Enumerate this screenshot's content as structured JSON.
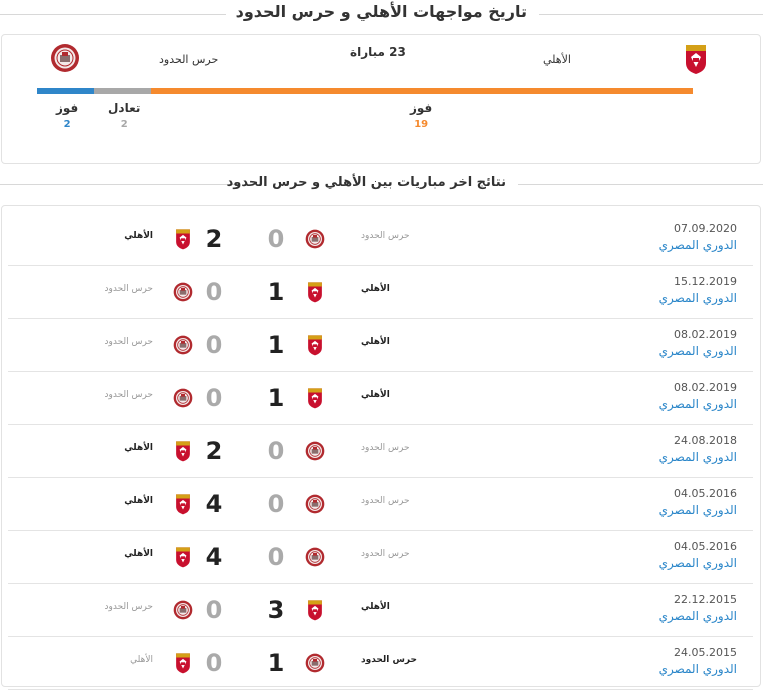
{
  "header": {
    "title": "تاريخ مواجهات الأهلي و حرس الحدود"
  },
  "summary": {
    "team_a": "الأهلي",
    "team_b": "حرس الحدود",
    "total": "23 مباراة",
    "wins_a_label": "فوز",
    "wins_a": "19",
    "draws_label": "تعادل",
    "draws": "2",
    "wins_b_label": "فوز",
    "wins_b": "2",
    "colors": {
      "team_a": "#f58a2e",
      "draw": "#a8a8a8",
      "team_b": "#2f86c9"
    },
    "bar_fractions": {
      "team_b": 0.087,
      "draw": 0.087,
      "team_a": 0.826
    }
  },
  "results": {
    "title": "نتائج اخر مباريات بين الأهلي و حرس الحدود",
    "rows": [
      {
        "date": "07.09.2020",
        "competition": "الدوري المصري",
        "home": "حرس الحدود",
        "home_logo": "haras-crest",
        "home_score": "0",
        "away_score": "2",
        "away": "الأهلي",
        "away_logo": "ahly-crest",
        "winner": "away"
      },
      {
        "date": "15.12.2019",
        "competition": "الدوري المصري",
        "home": "الأهلي",
        "home_logo": "ahly-crest",
        "home_score": "1",
        "away_score": "0",
        "away": "حرس الحدود",
        "away_logo": "haras-crest",
        "winner": "home"
      },
      {
        "date": "08.02.2019",
        "competition": "الدوري المصري",
        "home": "الأهلي",
        "home_logo": "ahly-crest",
        "home_score": "1",
        "away_score": "0",
        "away": "حرس الحدود",
        "away_logo": "haras-crest",
        "winner": "home"
      },
      {
        "date": "08.02.2019",
        "competition": "الدوري المصري",
        "home": "الأهلي",
        "home_logo": "ahly-crest",
        "home_score": "1",
        "away_score": "0",
        "away": "حرس الحدود",
        "away_logo": "haras-crest",
        "winner": "home"
      },
      {
        "date": "24.08.2018",
        "competition": "الدوري المصري",
        "home": "حرس الحدود",
        "home_logo": "haras-crest",
        "home_score": "0",
        "away_score": "2",
        "away": "الأهلي",
        "away_logo": "ahly-crest",
        "winner": "away"
      },
      {
        "date": "04.05.2016",
        "competition": "الدوري المصري",
        "home": "حرس الحدود",
        "home_logo": "haras-crest",
        "home_score": "0",
        "away_score": "4",
        "away": "الأهلي",
        "away_logo": "ahly-crest",
        "winner": "away"
      },
      {
        "date": "04.05.2016",
        "competition": "الدوري المصري",
        "home": "حرس الحدود",
        "home_logo": "haras-crest",
        "home_score": "0",
        "away_score": "4",
        "away": "الأهلي",
        "away_logo": "ahly-crest",
        "winner": "away"
      },
      {
        "date": "22.12.2015",
        "competition": "الدوري المصري",
        "home": "الأهلي",
        "home_logo": "ahly-crest",
        "home_score": "3",
        "away_score": "0",
        "away": "حرس الحدود",
        "away_logo": "haras-crest",
        "winner": "home"
      },
      {
        "date": "24.05.2015",
        "competition": "الدوري المصري",
        "home": "حرس الحدود",
        "home_logo": "haras-crest",
        "home_score": "1",
        "away_score": "0",
        "away": "الأهلي",
        "away_logo": "ahly-crest",
        "winner": "home"
      }
    ]
  }
}
